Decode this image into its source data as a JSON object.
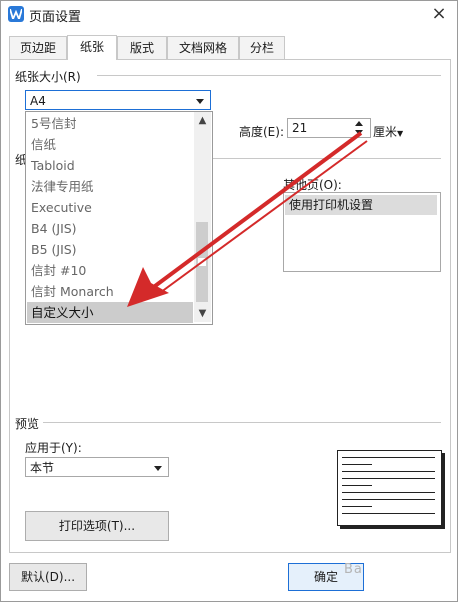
{
  "window": {
    "title": "页面设置",
    "close_symbol": "×"
  },
  "tabs": [
    {
      "label": "页边距",
      "active": false
    },
    {
      "label": "纸张",
      "active": true
    },
    {
      "label": "版式",
      "active": false
    },
    {
      "label": "文档网格",
      "active": false
    },
    {
      "label": "分栏",
      "active": false
    }
  ],
  "paper_size": {
    "group_label": "纸张大小(R)",
    "selected": "A4",
    "options": [
      "5号信封",
      "信纸",
      "Tabloid",
      "法律专用纸",
      "Executive",
      "B4 (JIS)",
      "B5 (JIS)",
      "信封 #10",
      "信封 Monarch",
      "自定义大小"
    ],
    "highlighted": "自定义大小",
    "height_label": "高度(E):",
    "height_value": "21",
    "unit": "厘米"
  },
  "paper_source": {
    "group_label_fragment": "纸",
    "other_pages_label": "其他页(O):",
    "other_pages_options": [
      "使用打印机设置"
    ]
  },
  "preview": {
    "group_label": "预览",
    "apply_to_label": "应用于(Y):",
    "apply_to_value": "本节",
    "print_options_button": "打印选项(T)..."
  },
  "footer": {
    "default_button": "默认(D)...",
    "ok_button": "确定",
    "watermark": "Ba"
  },
  "colors": {
    "accent": "#1d6fd6",
    "annotation_arrow": "#d42a2a",
    "app_icon": "#2a79d8"
  },
  "icons": {
    "app": "wps-writer-icon",
    "close": "close-icon",
    "dropdown": "chevron-down-icon"
  }
}
